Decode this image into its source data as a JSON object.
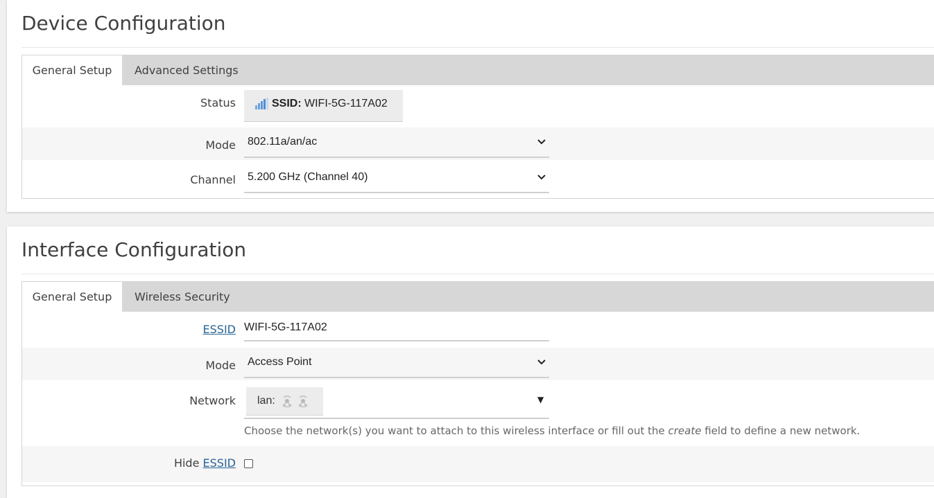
{
  "device": {
    "title": "Device Configuration",
    "tabs": [
      {
        "label": "General Setup",
        "active": true
      },
      {
        "label": "Advanced Settings",
        "active": false
      }
    ],
    "status": {
      "label": "Status",
      "ssid_key": "SSID:",
      "ssid_value": "WIFI-5G-117A02",
      "icon": "signal-bars-icon"
    },
    "mode": {
      "label": "Mode",
      "value": "802.11a/an/ac"
    },
    "channel": {
      "label": "Channel",
      "value": "5.200 GHz (Channel 40)"
    }
  },
  "interface": {
    "title": "Interface Configuration",
    "tabs": [
      {
        "label": "General Setup",
        "active": true
      },
      {
        "label": "Wireless Security",
        "active": false
      }
    ],
    "essid": {
      "label": "ESSID",
      "value": "WIFI-5G-117A02"
    },
    "mode": {
      "label": "Mode",
      "value": "Access Point"
    },
    "network": {
      "label": "Network",
      "chip": "lan:",
      "chip_icons": [
        "wifi-interface-icon",
        "wifi-interface-icon"
      ],
      "hint_before": "Choose the network(s) you want to attach to this wireless interface or fill out the",
      "hint_em": "create",
      "hint_after": "field to define a new network."
    },
    "hide_essid": {
      "label_prefix": "Hide",
      "label_link": "ESSID",
      "checked": false
    }
  },
  "colors": {
    "tab_bar": "#d7d7d7",
    "link": "#2a6496",
    "signal": "#4a90d9"
  }
}
